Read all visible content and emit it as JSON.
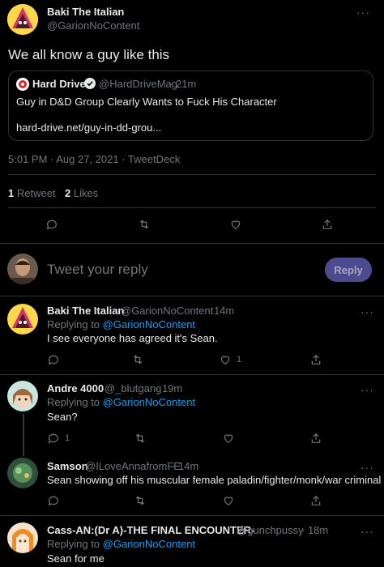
{
  "main_tweet": {
    "author_name": "Baki The Italian",
    "author_handle": "@GarionNoContent",
    "text": "We all know a guy like this",
    "quote": {
      "author_name": "Hard Drive",
      "author_handle": "@HardDriveMag",
      "time": "21m",
      "text": "Guy in D&D Group Clearly Wants to Fuck His Character",
      "link": "hard-drive.net/guy-in-dd-grou..."
    },
    "timestamp": "5:01 PM · Aug 27, 2021 · TweetDeck",
    "retweets_count": "1",
    "retweets_label": "Retweet",
    "likes_count": "2",
    "likes_label": "Likes"
  },
  "compose": {
    "placeholder": "Tweet your reply",
    "button_label": "Reply"
  },
  "replies": [
    {
      "author_name": "Baki The Italian",
      "author_handle": "@GarionNoContent",
      "time": "· 14m",
      "replying_prefix": "Replying to",
      "replying_to": "@GarionNoContent",
      "text": "I see everyone has agreed it's Sean.",
      "like_count": "1",
      "reply_count": ""
    },
    {
      "author_name": "Andre 4000",
      "author_handle": "@_blutgang",
      "time": "· 19m",
      "replying_prefix": "Replying to",
      "replying_to": "@GarionNoContent",
      "text": "Sean?",
      "reply_count": "1",
      "like_count": ""
    },
    {
      "author_name": "Samson",
      "author_handle": "@ILoveAnnafromFE",
      "time": "· 14m",
      "text": "Sean showing off his muscular female paladin/fighter/monk/war criminal"
    },
    {
      "author_name": "Cass-AN:(Dr A)-THE FINAL ENCOUNTER-",
      "author_handle": "@gunchpussy",
      "time": "· 18m",
      "replying_prefix": "Replying to",
      "replying_to": "@GarionNoContent",
      "text": "Sean for me"
    }
  ],
  "colors": {
    "background": "#000000",
    "text": "#e7e9ea",
    "muted": "#71767b",
    "accent": "#1d9bf0",
    "divider": "#2f3336"
  },
  "icons": [
    "more-icon",
    "verified-icon",
    "reply-icon",
    "retweet-icon",
    "like-icon",
    "share-icon"
  ]
}
